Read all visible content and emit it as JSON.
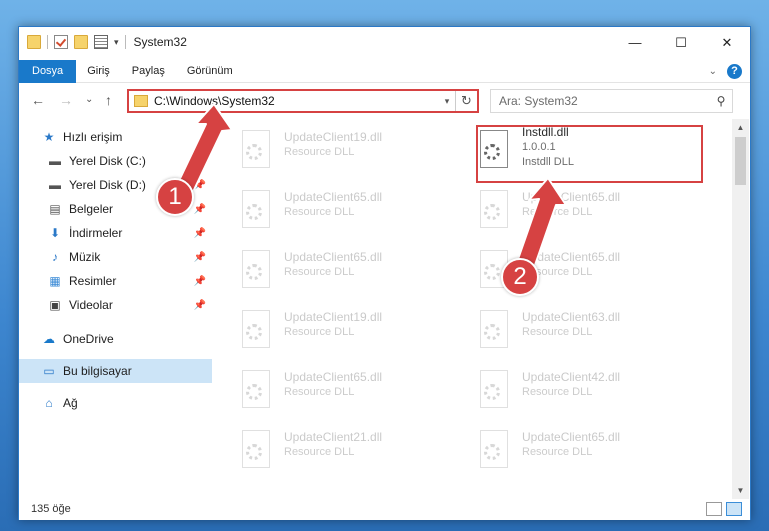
{
  "titlebar": {
    "title": "System32",
    "caret": "▾",
    "minimize": "—",
    "maximize": "☐",
    "close": "✕"
  },
  "ribbon": {
    "tabs": [
      "Dosya",
      "Giriş",
      "Paylaş",
      "Görünüm"
    ],
    "expand": "⌄",
    "help": "?"
  },
  "nav": {
    "back": "←",
    "forward": "→",
    "recent": "⌄",
    "up": "↑",
    "address": "C:\\Windows\\System32",
    "address_drop": "▾",
    "refresh": "↻",
    "search_placeholder": "Ara: System32",
    "search_icon": "⚲"
  },
  "sidebar": {
    "items": [
      {
        "label": "Hızlı erişim",
        "icon": "★"
      },
      {
        "label": "Yerel Disk (C:)",
        "icon": "▬",
        "pin": "📌"
      },
      {
        "label": "Yerel Disk (D:)",
        "icon": "▬",
        "pin": "📌"
      },
      {
        "label": "Belgeler",
        "icon": "▤",
        "pin": "📌"
      },
      {
        "label": "İndirmeler",
        "icon": "⬇",
        "pin": "📌"
      },
      {
        "label": "Müzik",
        "icon": "♪",
        "pin": "📌"
      },
      {
        "label": "Resimler",
        "icon": "▦",
        "pin": "📌"
      },
      {
        "label": "Videolar",
        "icon": "▣",
        "pin": "📌"
      },
      {
        "label": "OneDrive",
        "icon": "☁"
      },
      {
        "label": "Bu bilgisayar",
        "icon": "▭"
      },
      {
        "label": "Ağ",
        "icon": "⌂"
      }
    ]
  },
  "files": {
    "left": [
      {
        "name": "UpdateClient19.dll",
        "sub": "Resource DLL"
      },
      {
        "name": "UpdateClient65.dll",
        "sub": "Resource DLL"
      },
      {
        "name": "UpdateClient65.dll",
        "sub": "Resource DLL"
      },
      {
        "name": "UpdateClient19.dll",
        "sub": "Resource DLL"
      },
      {
        "name": "UpdateClient65.dll",
        "sub": "Resource DLL"
      },
      {
        "name": "UpdateClient21.dll",
        "sub": "Resource DLL"
      }
    ],
    "right": [
      {
        "name": "Instdll.dll",
        "sub": "1.0.0.1",
        "sub2": "Instdll DLL"
      },
      {
        "name": "UpdateClient65.dll",
        "sub": "Resource DLL"
      },
      {
        "name": "UpdateClient65.dll",
        "sub": "Resource DLL"
      },
      {
        "name": "UpdateClient63.dll",
        "sub": "Resource DLL"
      },
      {
        "name": "UpdateClient42.dll",
        "sub": "Resource DLL"
      },
      {
        "name": "UpdateClient65.dll",
        "sub": "Resource DLL"
      }
    ]
  },
  "scrollbar": {
    "up": "▲",
    "down": "▼"
  },
  "status": {
    "count": "135 öğe"
  },
  "annotations": {
    "step1": "1",
    "step2": "2",
    "color": "#d64242"
  }
}
